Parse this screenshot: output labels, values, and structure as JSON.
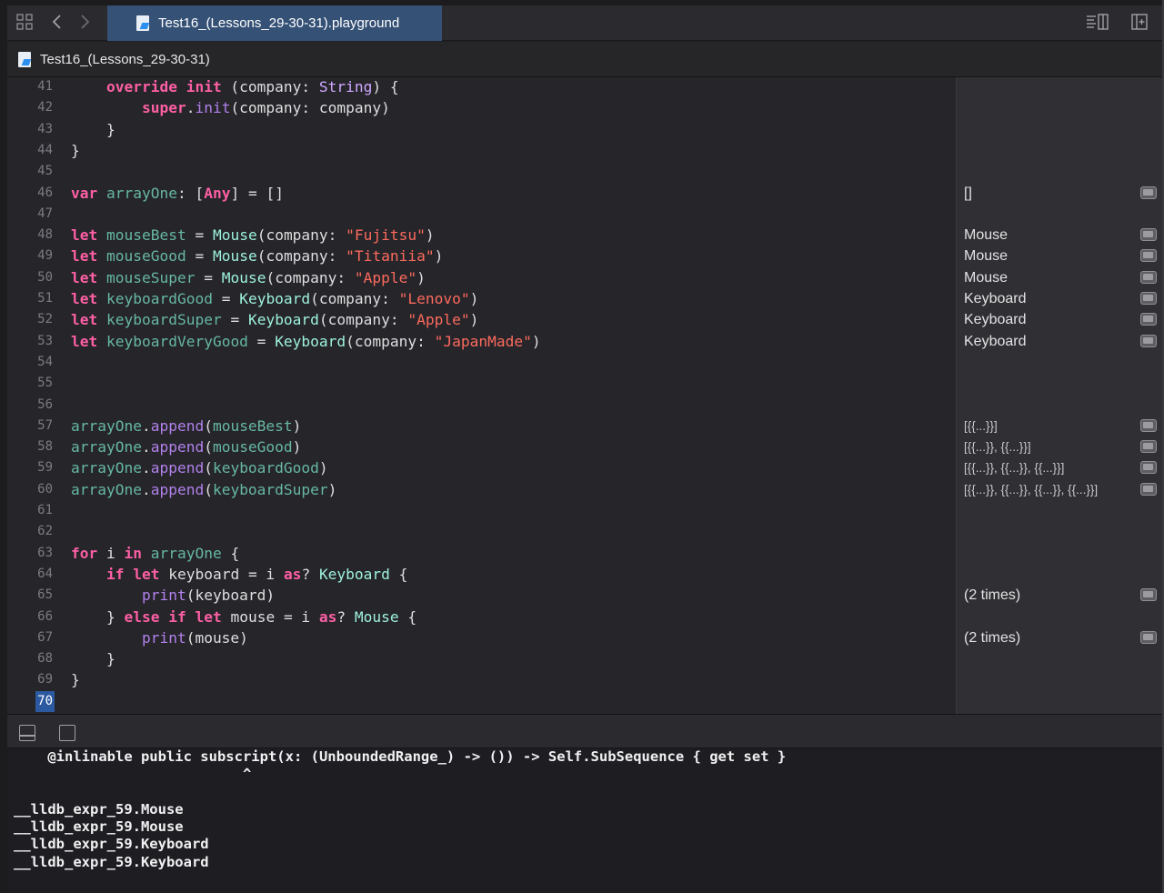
{
  "tabbar": {
    "active_tab": "Test16_(Lessons_29-30-31).playground",
    "icons": [
      "grid-icon",
      "back-icon",
      "forward-icon",
      "editor-options-icon",
      "add-editor-icon"
    ]
  },
  "breadcrumb": {
    "label": "Test16_(Lessons_29-30-31)"
  },
  "editor": {
    "lines": [
      {
        "n": "41",
        "html": "    <span class='kw'>override</span> <span class='kw'>init</span> (company: <span class='typ'>String</span>) {"
      },
      {
        "n": "42",
        "html": "        <span class='kw'>super</span>.<span class='fn'>init</span>(company: company)"
      },
      {
        "n": "43",
        "html": "    }"
      },
      {
        "n": "44",
        "html": "}"
      },
      {
        "n": "45",
        "html": ""
      },
      {
        "n": "46",
        "html": "<span class='kw'>var</span> <span class='decl'>arrayOne</span>: [<span class='kw'>Any</span>] = []"
      },
      {
        "n": "47",
        "html": ""
      },
      {
        "n": "48",
        "html": "<span class='kw'>let</span> <span class='decl'>mouseBest</span> = <span class='cls'>Mouse</span>(company: <span class='str'>\"Fujitsu\"</span>)"
      },
      {
        "n": "49",
        "html": "<span class='kw'>let</span> <span class='decl'>mouseGood</span> = <span class='cls'>Mouse</span>(company: <span class='str'>\"Titaniia\"</span>)"
      },
      {
        "n": "50",
        "html": "<span class='kw'>let</span> <span class='decl'>mouseSuper</span> = <span class='cls'>Mouse</span>(company: <span class='str'>\"Apple\"</span>)"
      },
      {
        "n": "51",
        "html": "<span class='kw'>let</span> <span class='decl'>keyboardGood</span> = <span class='cls'>Keyboard</span>(company: <span class='str'>\"Lenovo\"</span>)"
      },
      {
        "n": "52",
        "html": "<span class='kw'>let</span> <span class='decl'>keyboardSuper</span> = <span class='cls'>Keyboard</span>(company: <span class='str'>\"Apple\"</span>)"
      },
      {
        "n": "53",
        "html": "<span class='kw'>let</span> <span class='decl'>keyboardVeryGood</span> = <span class='cls'>Keyboard</span>(company: <span class='str'>\"JapanMade\"</span>)"
      },
      {
        "n": "54",
        "html": ""
      },
      {
        "n": "55",
        "html": ""
      },
      {
        "n": "56",
        "html": ""
      },
      {
        "n": "57",
        "html": "<span class='var'>arrayOne</span>.<span class='fn'>append</span>(<span class='var'>mouseBest</span>)"
      },
      {
        "n": "58",
        "html": "<span class='var'>arrayOne</span>.<span class='fn'>append</span>(<span class='var'>mouseGood</span>)"
      },
      {
        "n": "59",
        "html": "<span class='var'>arrayOne</span>.<span class='fn'>append</span>(<span class='var'>keyboardGood</span>)"
      },
      {
        "n": "60",
        "html": "<span class='var'>arrayOne</span>.<span class='fn'>append</span>(<span class='var'>keyboardSuper</span>)"
      },
      {
        "n": "61",
        "html": ""
      },
      {
        "n": "62",
        "html": ""
      },
      {
        "n": "63",
        "html": "<span class='kw'>for</span> i <span class='kw'>in</span> <span class='var'>arrayOne</span> {"
      },
      {
        "n": "64",
        "html": "    <span class='kw'>if</span> <span class='kw'>let</span> keyboard = i <span class='kw'>as</span>? <span class='cls'>Keyboard</span> {"
      },
      {
        "n": "65",
        "html": "        <span class='fn'>print</span>(keyboard)"
      },
      {
        "n": "66",
        "html": "    } <span class='kw'>else</span> <span class='kw'>if</span> <span class='kw'>let</span> mouse = i <span class='kw'>as</span>? <span class='cls'>Mouse</span> {"
      },
      {
        "n": "67",
        "html": "        <span class='fn'>print</span>(mouse)"
      },
      {
        "n": "68",
        "html": "    }"
      },
      {
        "n": "69",
        "html": "}"
      },
      {
        "n": "70",
        "html": "",
        "current": true
      }
    ]
  },
  "results": [
    {
      "line_index": 5,
      "text": "[]"
    },
    {
      "line_index": 7,
      "text": "Mouse"
    },
    {
      "line_index": 8,
      "text": "Mouse"
    },
    {
      "line_index": 9,
      "text": "Mouse"
    },
    {
      "line_index": 10,
      "text": "Keyboard"
    },
    {
      "line_index": 11,
      "text": "Keyboard"
    },
    {
      "line_index": 12,
      "text": "Keyboard"
    },
    {
      "line_index": 16,
      "text": "[{{...}}]",
      "small": true
    },
    {
      "line_index": 17,
      "text": "[{{...}}, {{...}}]",
      "small": true
    },
    {
      "line_index": 18,
      "text": "[{{...}}, {{...}}, {{...}}]",
      "small": true
    },
    {
      "line_index": 19,
      "text": "[{{...}}, {{...}}, {{...}}, {{...}}]",
      "small": true
    },
    {
      "line_index": 24,
      "text": "(2 times)"
    },
    {
      "line_index": 26,
      "text": "(2 times)"
    }
  ],
  "debugbar": {
    "icons": [
      "hide-debug-area-icon",
      "show-console-icon"
    ]
  },
  "console": {
    "lines": [
      "    @inlinable public subscript(x: (UnboundedRange_) -> ()) -> Self.SubSequence { get set }",
      "                           ^",
      "",
      "__lldb_expr_59.Mouse",
      "__lldb_expr_59.Mouse",
      "__lldb_expr_59.Keyboard",
      "__lldb_expr_59.Keyboard"
    ]
  }
}
